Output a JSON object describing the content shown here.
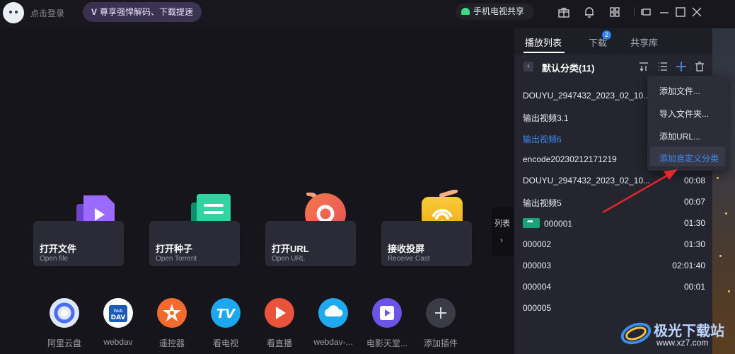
{
  "header": {
    "login_text": "点击登录",
    "vip_text": "尊享强悍解码、下载提速",
    "share_text": "手机电视共享"
  },
  "cards": [
    {
      "title": "打开文件",
      "subtitle": "Open file",
      "color": "#8b5cf6"
    },
    {
      "title": "打开种子",
      "subtitle": "Open Torrent",
      "color": "#19c08a"
    },
    {
      "title": "打开URL",
      "subtitle": "Open URL",
      "color": "#ef6a4c"
    },
    {
      "title": "接收投屏",
      "subtitle": "Receive Cast",
      "color": "#f5b21b"
    }
  ],
  "collapse": {
    "label": "列表",
    "chevron": "›"
  },
  "plugins": [
    {
      "label": "阿里云盘",
      "icon": "aliyun-icon",
      "color": "#dfe7fb"
    },
    {
      "label": "webdav",
      "icon": "webdav-icon",
      "color": "#ffffff"
    },
    {
      "label": "遥控器",
      "icon": "remote-icon",
      "color": "#f26b2c"
    },
    {
      "label": "看电视",
      "icon": "tv-icon",
      "color": "#1da7f0"
    },
    {
      "label": "看直播",
      "icon": "live-icon",
      "color": "#e9523b"
    },
    {
      "label": "webdav-...",
      "icon": "webdav2-icon",
      "color": "#21a9ef"
    },
    {
      "label": "电影天堂...",
      "icon": "movie-icon",
      "color": "#6c54e8"
    },
    {
      "label": "添加插件",
      "icon": "add-plugin-icon",
      "color": "#3a3b44"
    }
  ],
  "panel": {
    "tabs": [
      "播放列表",
      "下载",
      "共享库"
    ],
    "download_badge": "2",
    "category": "默认分类(11)",
    "back": "‹",
    "items": [
      {
        "name": "DOUYU_2947432_2023_02_10...",
        "duration": ""
      },
      {
        "name": "输出视频3.1",
        "duration": ""
      },
      {
        "name": "输出视频6",
        "duration": ""
      },
      {
        "name": "encode20230212171219",
        "duration": ""
      },
      {
        "name": "DOUYU_2947432_2023_02_10...",
        "duration": "00:08"
      },
      {
        "name": "输出视频5",
        "duration": "00:07"
      },
      {
        "name": "000001",
        "duration": "01:30"
      },
      {
        "name": "000002",
        "duration": "01:30"
      },
      {
        "name": "000003",
        "duration": "02:01:40"
      },
      {
        "name": "000004",
        "duration": "00:01"
      },
      {
        "name": "000005",
        "duration": ""
      }
    ]
  },
  "menu": {
    "items": [
      "添加文件...",
      "导入文件夹...",
      "添加URL...",
      "添加自定义分类"
    ]
  },
  "watermark": {
    "text": "极光下载站",
    "url": "www.xz7.com"
  }
}
